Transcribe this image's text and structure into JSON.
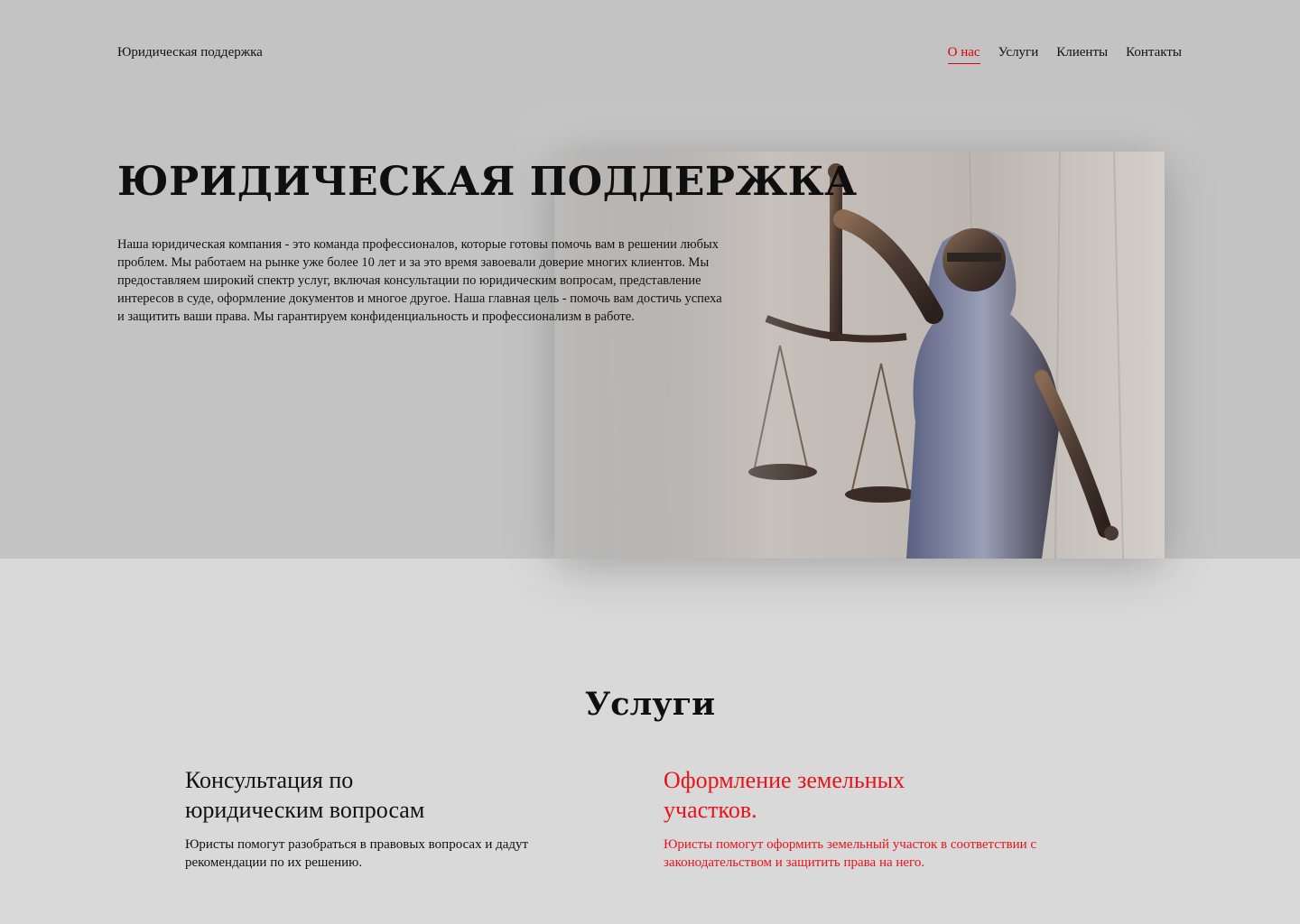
{
  "header": {
    "brand": "Юридическая поддержка",
    "nav": [
      {
        "label": "О нас",
        "active": true
      },
      {
        "label": "Услуги",
        "active": false
      },
      {
        "label": "Клиенты",
        "active": false
      },
      {
        "label": "Контакты",
        "active": false
      }
    ]
  },
  "hero": {
    "title": "ЮРИДИЧЕСКАЯ ПОДДЕРЖКА",
    "text": "Наша юридическая компания - это команда профессионалов, которые готовы помочь вам в решении любых проблем. Мы работаем на рынке уже более 10 лет и за это время завоевали доверие многих клиентов. Мы предоставляем широкий спектр услуг, включая консультации по юридическим вопросам, представление интересов в суде, оформление документов и многое другое. Наша главная цель - помочь вам достичь успеха и защитить ваши права. Мы гарантируем конфиденциальность и профессионализм в работе.",
    "image_icon": "lady-justice-statue-image"
  },
  "services": {
    "title": "Услуги",
    "items": [
      {
        "title": "Консультация по юридическим вопросам",
        "text": "Юристы помогут разобраться в правовых вопросах и дадут рекомендации по их решению.",
        "color": "#111111"
      },
      {
        "title": "Оформление земельных участков.",
        "text": "Юристы помогут оформить земельный участок в соответствии с законодательством и защитить права на него.",
        "color": "#e8141b"
      }
    ]
  },
  "colors": {
    "accent": "#e8141b",
    "hero_bg": "#c3c3c3",
    "page_bg": "#d9d9d9"
  }
}
